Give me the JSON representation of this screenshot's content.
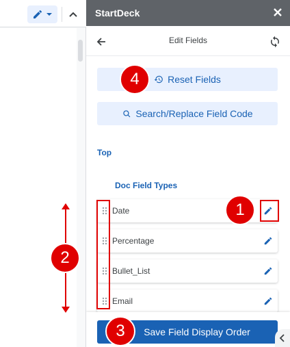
{
  "panel": {
    "title": "StartDeck",
    "header_title": "Edit Fields",
    "reset_label": "Reset Fields",
    "search_replace_label": "Search/Replace Field Code",
    "section_top": "Top",
    "section_doc_field_types": "Doc Field Types",
    "fields": [
      {
        "label": "Date"
      },
      {
        "label": "Percentage"
      },
      {
        "label": "Bullet_List"
      },
      {
        "label": "Email"
      }
    ],
    "save_label": "Save Field Display Order"
  },
  "annotations": {
    "badge_1": "1",
    "badge_2": "2",
    "badge_3": "3",
    "badge_4": "4"
  },
  "colors": {
    "accent": "#1a62b4",
    "accent_light": "#e8f0fe",
    "titlebar": "#5f6368",
    "annotation": "#e00000"
  }
}
